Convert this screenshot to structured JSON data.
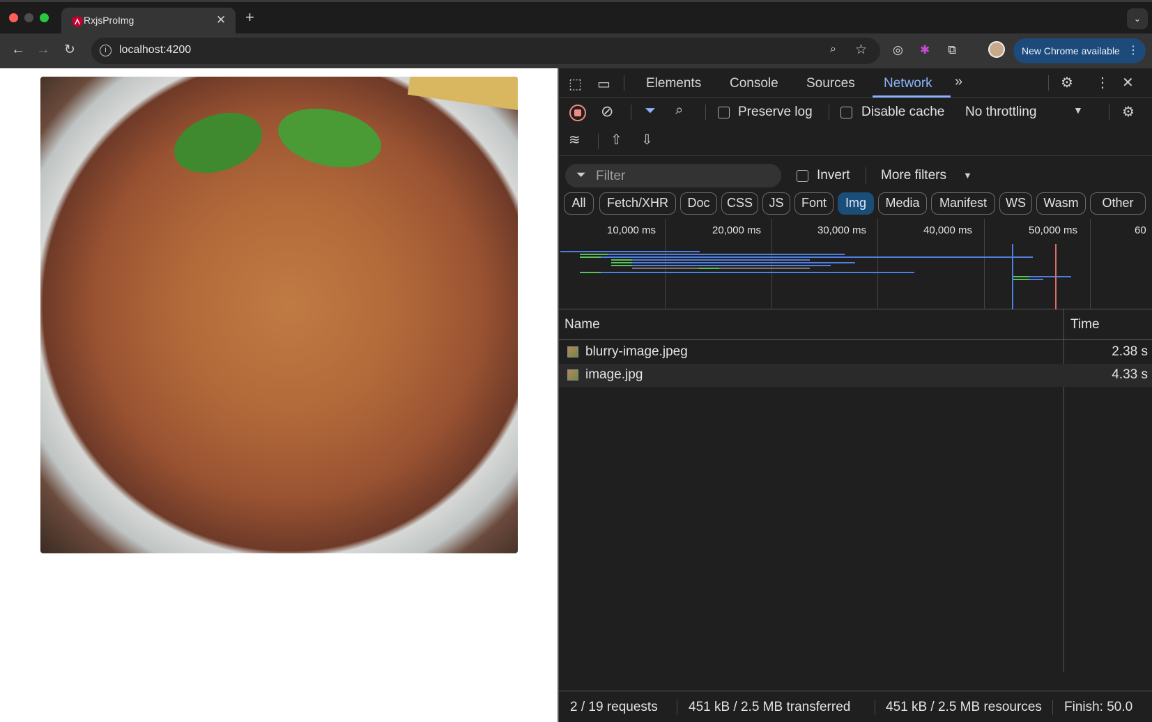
{
  "browser": {
    "tab_title": "RxjsProImg",
    "url": "localhost:4200",
    "update_label": "New Chrome available"
  },
  "page": {
    "image_alt": "Spaghetti bolognese with basil"
  },
  "devtools": {
    "tabs": [
      "Elements",
      "Console",
      "Sources",
      "Network"
    ],
    "active_tab": "Network",
    "preserve_log": "Preserve log",
    "disable_cache": "Disable cache",
    "throttling": "No throttling",
    "filter_placeholder": "Filter",
    "invert": "Invert",
    "more_filters": "More filters",
    "chips": [
      "All",
      "Fetch/XHR",
      "Doc",
      "CSS",
      "JS",
      "Font",
      "Img",
      "Media",
      "Manifest",
      "WS",
      "Wasm",
      "Other"
    ],
    "active_chip": "Img",
    "timeline_ticks": [
      "10,000 ms",
      "20,000 ms",
      "30,000 ms",
      "40,000 ms",
      "50,000 ms",
      "60"
    ],
    "columns": {
      "name": "Name",
      "time": "Time"
    },
    "rows": [
      {
        "name": "blurry-image.jpeg",
        "time": "2.38 s"
      },
      {
        "name": "image.jpg",
        "time": "4.33 s"
      }
    ],
    "status": {
      "requests": "2 / 19 requests",
      "transferred": "451 kB / 2.5 MB transferred",
      "resources": "451 kB / 2.5 MB resources",
      "finish": "Finish: 50.0"
    }
  },
  "colors": {
    "accent": "#8ab4f8",
    "record": "#f28b82",
    "chip_active": "#1a4d78"
  }
}
